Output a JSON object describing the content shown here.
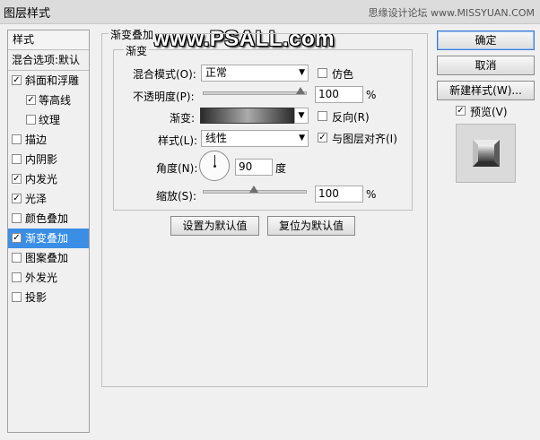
{
  "window": {
    "title": "图层样式",
    "watermark_top": "思缘设计论坛 www.MISSYUAN.COM",
    "watermark_big": "www.PSALL.com"
  },
  "sidebar": {
    "header": "样式",
    "blend_options": "混合选项:默认",
    "items": [
      {
        "label": "斜面和浮雕",
        "checked": true,
        "indent": false,
        "selected": false
      },
      {
        "label": "等高线",
        "checked": true,
        "indent": true,
        "selected": false
      },
      {
        "label": "纹理",
        "checked": false,
        "indent": true,
        "selected": false
      },
      {
        "label": "描边",
        "checked": false,
        "indent": false,
        "selected": false
      },
      {
        "label": "内阴影",
        "checked": false,
        "indent": false,
        "selected": false
      },
      {
        "label": "内发光",
        "checked": true,
        "indent": false,
        "selected": false
      },
      {
        "label": "光泽",
        "checked": true,
        "indent": false,
        "selected": false
      },
      {
        "label": "颜色叠加",
        "checked": false,
        "indent": false,
        "selected": false
      },
      {
        "label": "渐变叠加",
        "checked": true,
        "indent": false,
        "selected": true
      },
      {
        "label": "图案叠加",
        "checked": false,
        "indent": false,
        "selected": false
      },
      {
        "label": "外发光",
        "checked": false,
        "indent": false,
        "selected": false
      },
      {
        "label": "投影",
        "checked": false,
        "indent": false,
        "selected": false
      }
    ]
  },
  "panel": {
    "group_title": "渐变叠加",
    "subgroup_title": "渐变",
    "blend_mode": {
      "label": "混合模式(O):",
      "value": "正常"
    },
    "dither": {
      "label": "仿色",
      "checked": false
    },
    "opacity": {
      "label": "不透明度(P):",
      "value": "100",
      "unit": "%",
      "level": 1.0
    },
    "gradient": {
      "label": "渐变:",
      "colors": [
        "#2a2a2a",
        "#ababab",
        "#2a2a2a"
      ]
    },
    "reverse": {
      "label": "反向(R)",
      "checked": false
    },
    "style": {
      "label": "样式(L):",
      "value": "线性"
    },
    "align_layer": {
      "label": "与图层对齐(I)",
      "checked": true
    },
    "angle": {
      "label": "角度(N):",
      "value": "90",
      "unit": "度"
    },
    "scale": {
      "label": "缩放(S):",
      "value": "100",
      "unit": "%",
      "level": 0.5
    },
    "set_default": "设置为默认值",
    "reset_default": "复位为默认值"
  },
  "actions": {
    "ok": "确定",
    "cancel": "取消",
    "new_style": "新建样式(W)...",
    "preview": {
      "label": "预览(V)",
      "checked": true
    }
  },
  "check_glyph": "✓",
  "arrow_glyph": "▼"
}
